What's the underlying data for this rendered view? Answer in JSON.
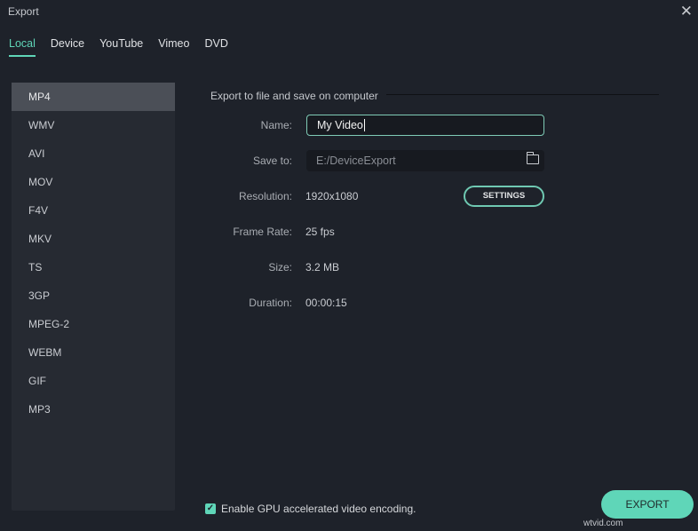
{
  "window": {
    "title": "Export",
    "close_icon": "close-icon"
  },
  "tabs": [
    {
      "label": "Local",
      "active": true
    },
    {
      "label": "Device"
    },
    {
      "label": "YouTube"
    },
    {
      "label": "Vimeo"
    },
    {
      "label": "DVD"
    }
  ],
  "formats": [
    "MP4",
    "WMV",
    "AVI",
    "MOV",
    "F4V",
    "MKV",
    "TS",
    "3GP",
    "MPEG-2",
    "WEBM",
    "GIF",
    "MP3"
  ],
  "selected_format": "MP4",
  "main": {
    "section_title": "Export to file and save on computer",
    "name_label": "Name:",
    "name_value": "My Video",
    "save_label": "Save to:",
    "save_value": "E:/DeviceExport",
    "folder_icon": "folder-icon",
    "resolution_label": "Resolution:",
    "resolution_value": "1920x1080",
    "settings_button": "SETTINGS",
    "framerate_label": "Frame Rate:",
    "framerate_value": "25 fps",
    "size_label": "Size:",
    "size_value": "3.2 MB",
    "duration_label": "Duration:",
    "duration_value": "00:00:15"
  },
  "gpu": {
    "label": "Enable GPU accelerated video encoding.",
    "checked": true
  },
  "export_button": "EXPORT",
  "watermark": "wtvid.com",
  "colors": {
    "accent": "#5fd6b8",
    "background": "#1e222a"
  }
}
